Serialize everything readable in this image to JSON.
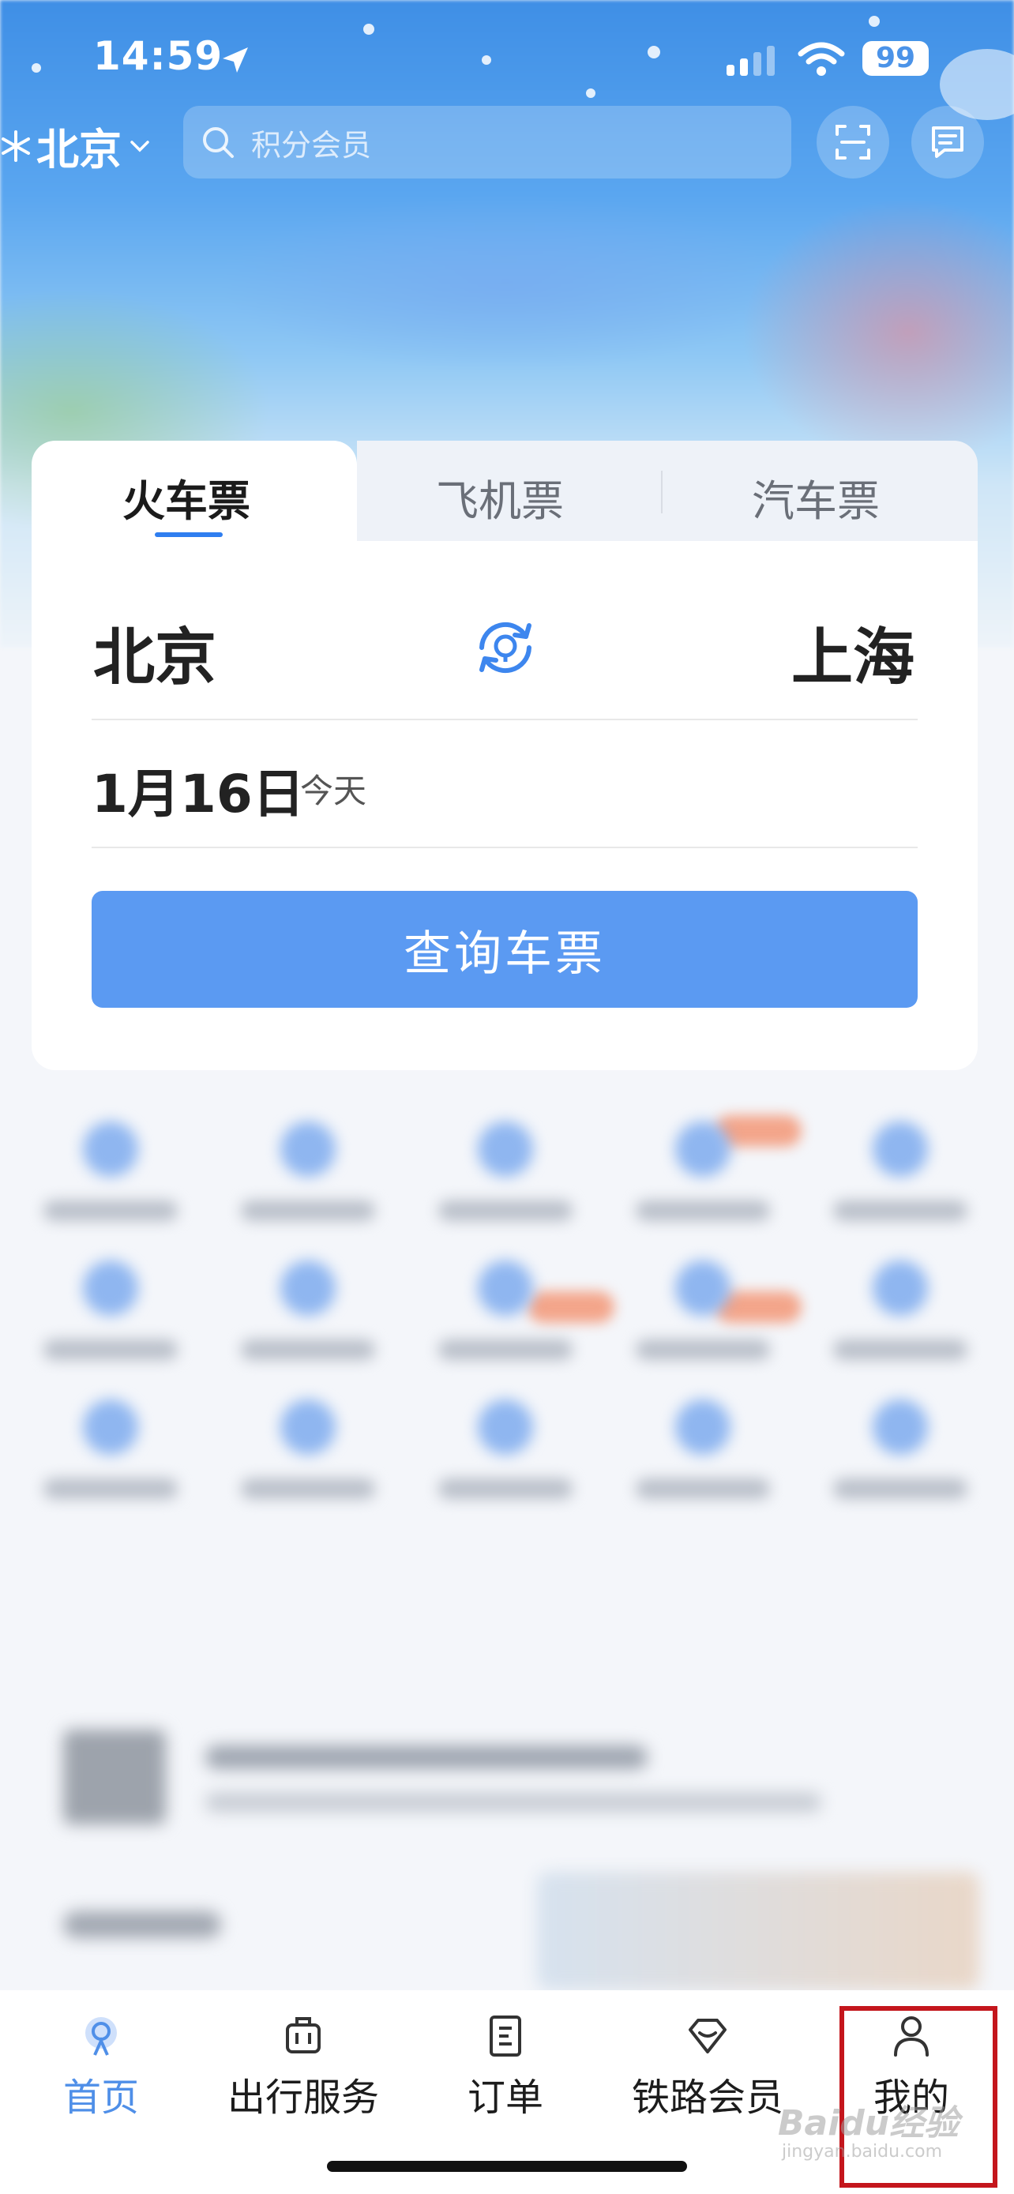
{
  "status_bar": {
    "time": "14:59",
    "battery": "99"
  },
  "header": {
    "city": "北京",
    "search_placeholder": "积分会员"
  },
  "ticket_tabs": [
    {
      "label": "火车票",
      "active": true
    },
    {
      "label": "飞机票",
      "active": false
    },
    {
      "label": "汽车票",
      "active": false
    }
  ],
  "route": {
    "from": "北京",
    "to": "上海"
  },
  "date": {
    "value": "1月16日",
    "day_note": "今天"
  },
  "query_button": "查询车票",
  "tab_bar": [
    {
      "label": "首页",
      "icon": "home-icon",
      "active": true
    },
    {
      "label": "出行服务",
      "icon": "luggage-icon",
      "active": false
    },
    {
      "label": "订单",
      "icon": "order-icon",
      "active": false
    },
    {
      "label": "铁路会员",
      "icon": "diamond-icon",
      "active": false
    },
    {
      "label": "我的",
      "icon": "person-icon",
      "active": false
    }
  ],
  "watermark": {
    "text": "Baidu经验",
    "sub": "jingyan.baidu.com"
  },
  "colors": {
    "accent": "#4f8fe8",
    "button": "#5b9af2",
    "highlight_box": "#c4161c"
  }
}
